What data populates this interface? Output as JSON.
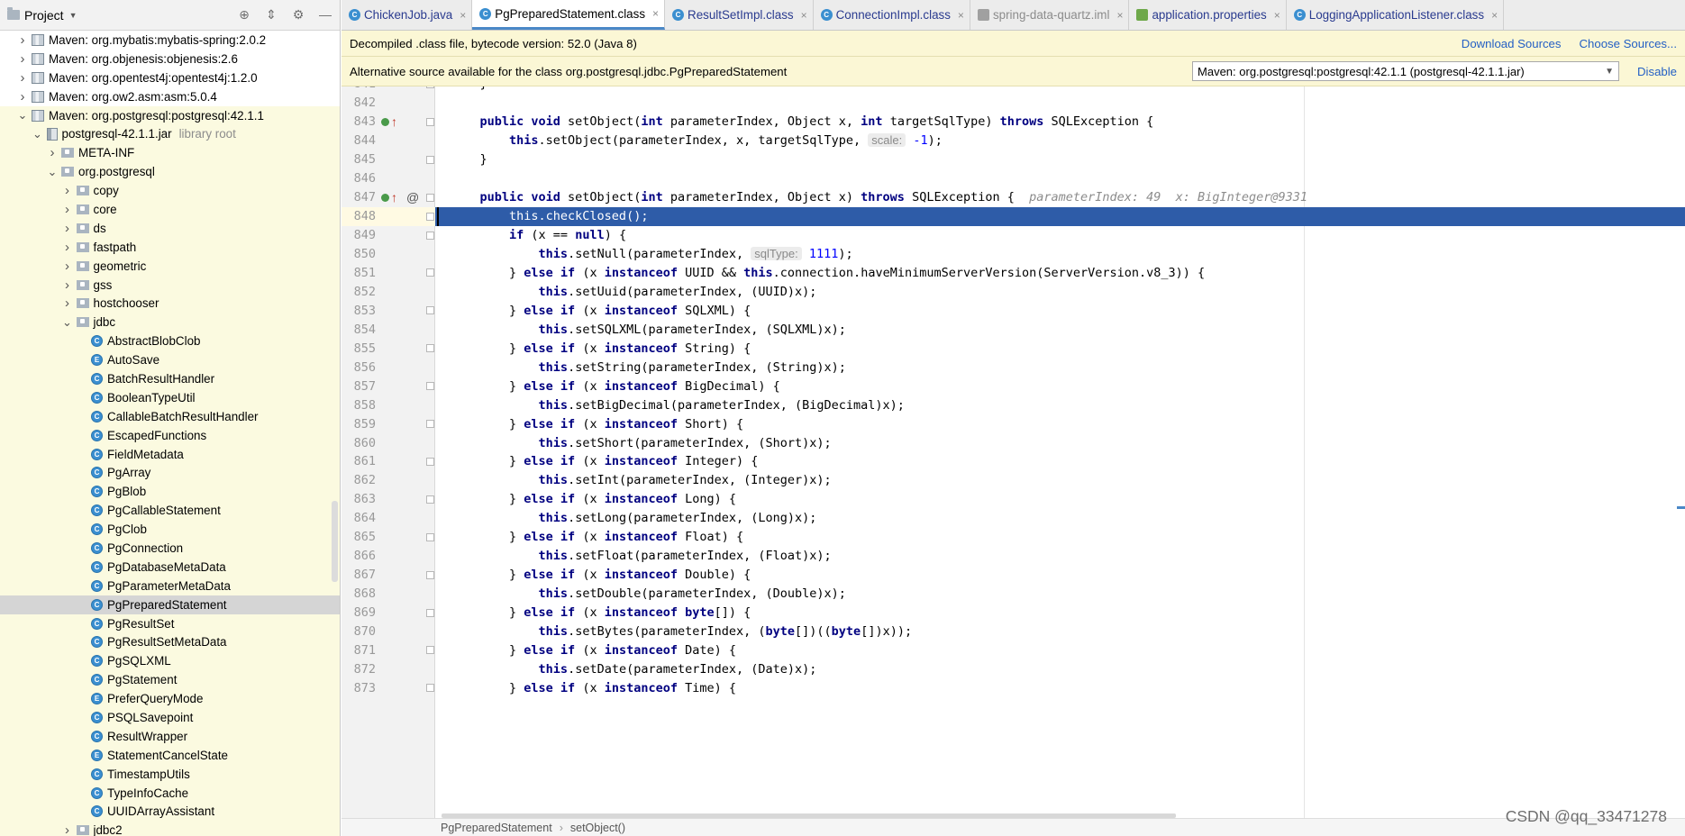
{
  "project_panel": {
    "title": "Project",
    "tree": [
      {
        "label": "Maven: org.mybatis:mybatis-spring:2.0.2",
        "type": "library",
        "expanded": false
      },
      {
        "label": "Maven: org.objenesis:objenesis:2.6",
        "type": "library",
        "expanded": false
      },
      {
        "label": "Maven: org.opentest4j:opentest4j:1.2.0",
        "type": "library",
        "expanded": false
      },
      {
        "label": "Maven: org.ow2.asm:asm:5.0.4",
        "type": "library",
        "expanded": false
      },
      {
        "label": "Maven: org.postgresql:postgresql:42.1.1",
        "type": "library",
        "expanded": true
      },
      {
        "label": "postgresql-42.1.1.jar",
        "suffix": "library root",
        "type": "jar",
        "expanded": true
      },
      {
        "label": "META-INF",
        "type": "folder",
        "expanded": false
      },
      {
        "label": "org.postgresql",
        "type": "package",
        "expanded": true
      },
      {
        "label": "copy",
        "type": "package",
        "expanded": false
      },
      {
        "label": "core",
        "type": "package",
        "expanded": false
      },
      {
        "label": "ds",
        "type": "package",
        "expanded": false
      },
      {
        "label": "fastpath",
        "type": "package",
        "expanded": false
      },
      {
        "label": "geometric",
        "type": "package",
        "expanded": false
      },
      {
        "label": "gss",
        "type": "package",
        "expanded": false
      },
      {
        "label": "hostchooser",
        "type": "package",
        "expanded": false
      },
      {
        "label": "jdbc",
        "type": "package",
        "expanded": true
      },
      {
        "label": "AbstractBlobClob",
        "type": "class"
      },
      {
        "label": "AutoSave",
        "type": "enum"
      },
      {
        "label": "BatchResultHandler",
        "type": "class"
      },
      {
        "label": "BooleanTypeUtil",
        "type": "class"
      },
      {
        "label": "CallableBatchResultHandler",
        "type": "class"
      },
      {
        "label": "EscapedFunctions",
        "type": "class"
      },
      {
        "label": "FieldMetadata",
        "type": "class"
      },
      {
        "label": "PgArray",
        "type": "class"
      },
      {
        "label": "PgBlob",
        "type": "class"
      },
      {
        "label": "PgCallableStatement",
        "type": "class"
      },
      {
        "label": "PgClob",
        "type": "class"
      },
      {
        "label": "PgConnection",
        "type": "class"
      },
      {
        "label": "PgDatabaseMetaData",
        "type": "class"
      },
      {
        "label": "PgParameterMetaData",
        "type": "class"
      },
      {
        "label": "PgPreparedStatement",
        "type": "class",
        "selected": true
      },
      {
        "label": "PgResultSet",
        "type": "class"
      },
      {
        "label": "PgResultSetMetaData",
        "type": "class"
      },
      {
        "label": "PgSQLXML",
        "type": "class"
      },
      {
        "label": "PgStatement",
        "type": "class"
      },
      {
        "label": "PreferQueryMode",
        "type": "enum"
      },
      {
        "label": "PSQLSavepoint",
        "type": "class"
      },
      {
        "label": "ResultWrapper",
        "type": "class"
      },
      {
        "label": "StatementCancelState",
        "type": "enum"
      },
      {
        "label": "TimestampUtils",
        "type": "class"
      },
      {
        "label": "TypeInfoCache",
        "type": "class"
      },
      {
        "label": "UUIDArrayAssistant",
        "type": "class"
      },
      {
        "label": "jdbc2",
        "type": "package",
        "expanded": false
      }
    ]
  },
  "tabs": [
    {
      "label": "ChickenJob.java",
      "icon": "class-icon",
      "active": false,
      "dim": false
    },
    {
      "label": "PgPreparedStatement.class",
      "icon": "class-icon",
      "active": true,
      "dim": false
    },
    {
      "label": "ResultSetImpl.class",
      "icon": "class-icon",
      "active": false,
      "dim": false
    },
    {
      "label": "ConnectionImpl.class",
      "icon": "class-icon",
      "active": false,
      "dim": false
    },
    {
      "label": "spring-data-quartz.iml",
      "icon": "module-file-icon",
      "active": false,
      "dim": true
    },
    {
      "label": "application.properties",
      "icon": "properties-file-icon",
      "active": false,
      "dim": false
    },
    {
      "label": "LoggingApplicationListener.class",
      "icon": "class-icon",
      "active": false,
      "dim": false
    }
  ],
  "banner1": {
    "text": "Decompiled .class file, bytecode version: 52.0 (Java 8)",
    "download_sources": "Download Sources",
    "choose_sources": "Choose Sources..."
  },
  "banner2": {
    "text": "Alternative source available for the class org.postgresql.jdbc.PgPreparedStatement",
    "source_option": "Maven: org.postgresql:postgresql:42.1.1 (postgresql-42.1.1.jar)",
    "disable": "Disable"
  },
  "code": {
    "current_line": "848",
    "lines": [
      {
        "n": "841",
        "tokens": [
          {
            "t": "    }",
            "c": "p"
          }
        ]
      },
      {
        "n": "842",
        "tokens": []
      },
      {
        "n": "843",
        "marker": "impl-override",
        "tokens": [
          {
            "t": "    ",
            "c": "p"
          },
          {
            "t": "public void",
            "c": "k"
          },
          {
            "t": " setObject(",
            "c": "p"
          },
          {
            "t": "int",
            "c": "k"
          },
          {
            "t": " parameterIndex, Object x, ",
            "c": "p"
          },
          {
            "t": "int",
            "c": "k"
          },
          {
            "t": " targetSqlType) ",
            "c": "p"
          },
          {
            "t": "throws",
            "c": "k"
          },
          {
            "t": " SQLException {",
            "c": "p"
          }
        ]
      },
      {
        "n": "844",
        "tokens": [
          {
            "t": "        ",
            "c": "p"
          },
          {
            "t": "this",
            "c": "k"
          },
          {
            "t": ".setObject(parameterIndex, x, targetSqlType, ",
            "c": "p"
          },
          {
            "t": "scale:",
            "c": "h"
          },
          {
            "t": " ",
            "c": "p"
          },
          {
            "t": "-1",
            "c": "n"
          },
          {
            "t": ");",
            "c": "p"
          }
        ]
      },
      {
        "n": "845",
        "tokens": [
          {
            "t": "    }",
            "c": "p"
          }
        ]
      },
      {
        "n": "846",
        "tokens": []
      },
      {
        "n": "847",
        "marker": "impl-override-annotated",
        "tokens": [
          {
            "t": "    ",
            "c": "p"
          },
          {
            "t": "public void",
            "c": "k"
          },
          {
            "t": " setObject(",
            "c": "p"
          },
          {
            "t": "int",
            "c": "k"
          },
          {
            "t": " parameterIndex, Object x) ",
            "c": "p"
          },
          {
            "t": "throws",
            "c": "k"
          },
          {
            "t": " SQLException {  ",
            "c": "p"
          },
          {
            "t": "parameterIndex: 49  x: BigInteger@9331",
            "c": "d"
          }
        ]
      },
      {
        "n": "848",
        "current": true,
        "tokens": [
          {
            "t": "        this.checkClosed();",
            "c": "w"
          }
        ]
      },
      {
        "n": "849",
        "tokens": [
          {
            "t": "        ",
            "c": "p"
          },
          {
            "t": "if",
            "c": "k"
          },
          {
            "t": " (x == ",
            "c": "p"
          },
          {
            "t": "null",
            "c": "k"
          },
          {
            "t": ") {",
            "c": "p"
          }
        ]
      },
      {
        "n": "850",
        "tokens": [
          {
            "t": "            ",
            "c": "p"
          },
          {
            "t": "this",
            "c": "k"
          },
          {
            "t": ".setNull(parameterIndex, ",
            "c": "p"
          },
          {
            "t": "sqlType:",
            "c": "h"
          },
          {
            "t": " ",
            "c": "p"
          },
          {
            "t": "1111",
            "c": "n"
          },
          {
            "t": ");",
            "c": "p"
          }
        ]
      },
      {
        "n": "851",
        "tokens": [
          {
            "t": "        } ",
            "c": "p"
          },
          {
            "t": "else if",
            "c": "k"
          },
          {
            "t": " (x ",
            "c": "p"
          },
          {
            "t": "instanceof",
            "c": "k"
          },
          {
            "t": " UUID && ",
            "c": "p"
          },
          {
            "t": "this",
            "c": "k"
          },
          {
            "t": ".connection.haveMinimumServerVersion(ServerVersion.v8_3)) {",
            "c": "p"
          }
        ]
      },
      {
        "n": "852",
        "tokens": [
          {
            "t": "            ",
            "c": "p"
          },
          {
            "t": "this",
            "c": "k"
          },
          {
            "t": ".setUuid(parameterIndex, (UUID)x);",
            "c": "p"
          }
        ]
      },
      {
        "n": "853",
        "tokens": [
          {
            "t": "        } ",
            "c": "p"
          },
          {
            "t": "else if",
            "c": "k"
          },
          {
            "t": " (x ",
            "c": "p"
          },
          {
            "t": "instanceof",
            "c": "k"
          },
          {
            "t": " SQLXML) {",
            "c": "p"
          }
        ]
      },
      {
        "n": "854",
        "tokens": [
          {
            "t": "            ",
            "c": "p"
          },
          {
            "t": "this",
            "c": "k"
          },
          {
            "t": ".setSQLXML(parameterIndex, (SQLXML)x);",
            "c": "p"
          }
        ]
      },
      {
        "n": "855",
        "tokens": [
          {
            "t": "        } ",
            "c": "p"
          },
          {
            "t": "else if",
            "c": "k"
          },
          {
            "t": " (x ",
            "c": "p"
          },
          {
            "t": "instanceof",
            "c": "k"
          },
          {
            "t": " String) {",
            "c": "p"
          }
        ]
      },
      {
        "n": "856",
        "tokens": [
          {
            "t": "            ",
            "c": "p"
          },
          {
            "t": "this",
            "c": "k"
          },
          {
            "t": ".setString(parameterIndex, (String)x);",
            "c": "p"
          }
        ]
      },
      {
        "n": "857",
        "tokens": [
          {
            "t": "        } ",
            "c": "p"
          },
          {
            "t": "else if",
            "c": "k"
          },
          {
            "t": " (x ",
            "c": "p"
          },
          {
            "t": "instanceof",
            "c": "k"
          },
          {
            "t": " BigDecimal) {",
            "c": "p"
          }
        ]
      },
      {
        "n": "858",
        "tokens": [
          {
            "t": "            ",
            "c": "p"
          },
          {
            "t": "this",
            "c": "k"
          },
          {
            "t": ".setBigDecimal(parameterIndex, (BigDecimal)x);",
            "c": "p"
          }
        ]
      },
      {
        "n": "859",
        "tokens": [
          {
            "t": "        } ",
            "c": "p"
          },
          {
            "t": "else if",
            "c": "k"
          },
          {
            "t": " (x ",
            "c": "p"
          },
          {
            "t": "instanceof",
            "c": "k"
          },
          {
            "t": " Short) {",
            "c": "p"
          }
        ]
      },
      {
        "n": "860",
        "tokens": [
          {
            "t": "            ",
            "c": "p"
          },
          {
            "t": "this",
            "c": "k"
          },
          {
            "t": ".setShort(parameterIndex, (Short)x);",
            "c": "p"
          }
        ]
      },
      {
        "n": "861",
        "tokens": [
          {
            "t": "        } ",
            "c": "p"
          },
          {
            "t": "else if",
            "c": "k"
          },
          {
            "t": " (x ",
            "c": "p"
          },
          {
            "t": "instanceof",
            "c": "k"
          },
          {
            "t": " Integer) {",
            "c": "p"
          }
        ]
      },
      {
        "n": "862",
        "tokens": [
          {
            "t": "            ",
            "c": "p"
          },
          {
            "t": "this",
            "c": "k"
          },
          {
            "t": ".setInt(parameterIndex, (Integer)x);",
            "c": "p"
          }
        ]
      },
      {
        "n": "863",
        "tokens": [
          {
            "t": "        } ",
            "c": "p"
          },
          {
            "t": "else if",
            "c": "k"
          },
          {
            "t": " (x ",
            "c": "p"
          },
          {
            "t": "instanceof",
            "c": "k"
          },
          {
            "t": " Long) {",
            "c": "p"
          }
        ]
      },
      {
        "n": "864",
        "tokens": [
          {
            "t": "            ",
            "c": "p"
          },
          {
            "t": "this",
            "c": "k"
          },
          {
            "t": ".setLong(parameterIndex, (Long)x);",
            "c": "p"
          }
        ]
      },
      {
        "n": "865",
        "tokens": [
          {
            "t": "        } ",
            "c": "p"
          },
          {
            "t": "else if",
            "c": "k"
          },
          {
            "t": " (x ",
            "c": "p"
          },
          {
            "t": "instanceof",
            "c": "k"
          },
          {
            "t": " Float) {",
            "c": "p"
          }
        ]
      },
      {
        "n": "866",
        "tokens": [
          {
            "t": "            ",
            "c": "p"
          },
          {
            "t": "this",
            "c": "k"
          },
          {
            "t": ".setFloat(parameterIndex, (Float)x);",
            "c": "p"
          }
        ]
      },
      {
        "n": "867",
        "tokens": [
          {
            "t": "        } ",
            "c": "p"
          },
          {
            "t": "else if",
            "c": "k"
          },
          {
            "t": " (x ",
            "c": "p"
          },
          {
            "t": "instanceof",
            "c": "k"
          },
          {
            "t": " Double) {",
            "c": "p"
          }
        ]
      },
      {
        "n": "868",
        "tokens": [
          {
            "t": "            ",
            "c": "p"
          },
          {
            "t": "this",
            "c": "k"
          },
          {
            "t": ".setDouble(parameterIndex, (Double)x);",
            "c": "p"
          }
        ]
      },
      {
        "n": "869",
        "tokens": [
          {
            "t": "        } ",
            "c": "p"
          },
          {
            "t": "else if",
            "c": "k"
          },
          {
            "t": " (x ",
            "c": "p"
          },
          {
            "t": "instanceof",
            "c": "k"
          },
          {
            "t": " ",
            "c": "p"
          },
          {
            "t": "byte",
            "c": "k"
          },
          {
            "t": "[]) {",
            "c": "p"
          }
        ]
      },
      {
        "n": "870",
        "tokens": [
          {
            "t": "            ",
            "c": "p"
          },
          {
            "t": "this",
            "c": "k"
          },
          {
            "t": ".setBytes(parameterIndex, (",
            "c": "p"
          },
          {
            "t": "byte",
            "c": "k"
          },
          {
            "t": "[])((",
            "c": "p"
          },
          {
            "t": "byte",
            "c": "k"
          },
          {
            "t": "[])x));",
            "c": "p"
          }
        ]
      },
      {
        "n": "871",
        "tokens": [
          {
            "t": "        } ",
            "c": "p"
          },
          {
            "t": "else if",
            "c": "k"
          },
          {
            "t": " (x ",
            "c": "p"
          },
          {
            "t": "instanceof",
            "c": "k"
          },
          {
            "t": " Date) {",
            "c": "p"
          }
        ]
      },
      {
        "n": "872",
        "tokens": [
          {
            "t": "            ",
            "c": "p"
          },
          {
            "t": "this",
            "c": "k"
          },
          {
            "t": ".setDate(parameterIndex, (Date)x);",
            "c": "p"
          }
        ]
      },
      {
        "n": "873",
        "tokens": [
          {
            "t": "        } ",
            "c": "p"
          },
          {
            "t": "else if",
            "c": "k"
          },
          {
            "t": " (x ",
            "c": "p"
          },
          {
            "t": "instanceof",
            "c": "k"
          },
          {
            "t": " Time) {",
            "c": "p"
          }
        ]
      }
    ]
  },
  "breadcrumb": [
    "PgPreparedStatement",
    "setObject()"
  ],
  "watermark": "CSDN @qq_33471278",
  "colors": {
    "keyword": "#000080",
    "number": "#0000ff",
    "current_line_bg": "#2e5ca8",
    "banner_bg": "#fbf7d5",
    "link": "#2460c4",
    "selection": "#d5d5d5"
  }
}
